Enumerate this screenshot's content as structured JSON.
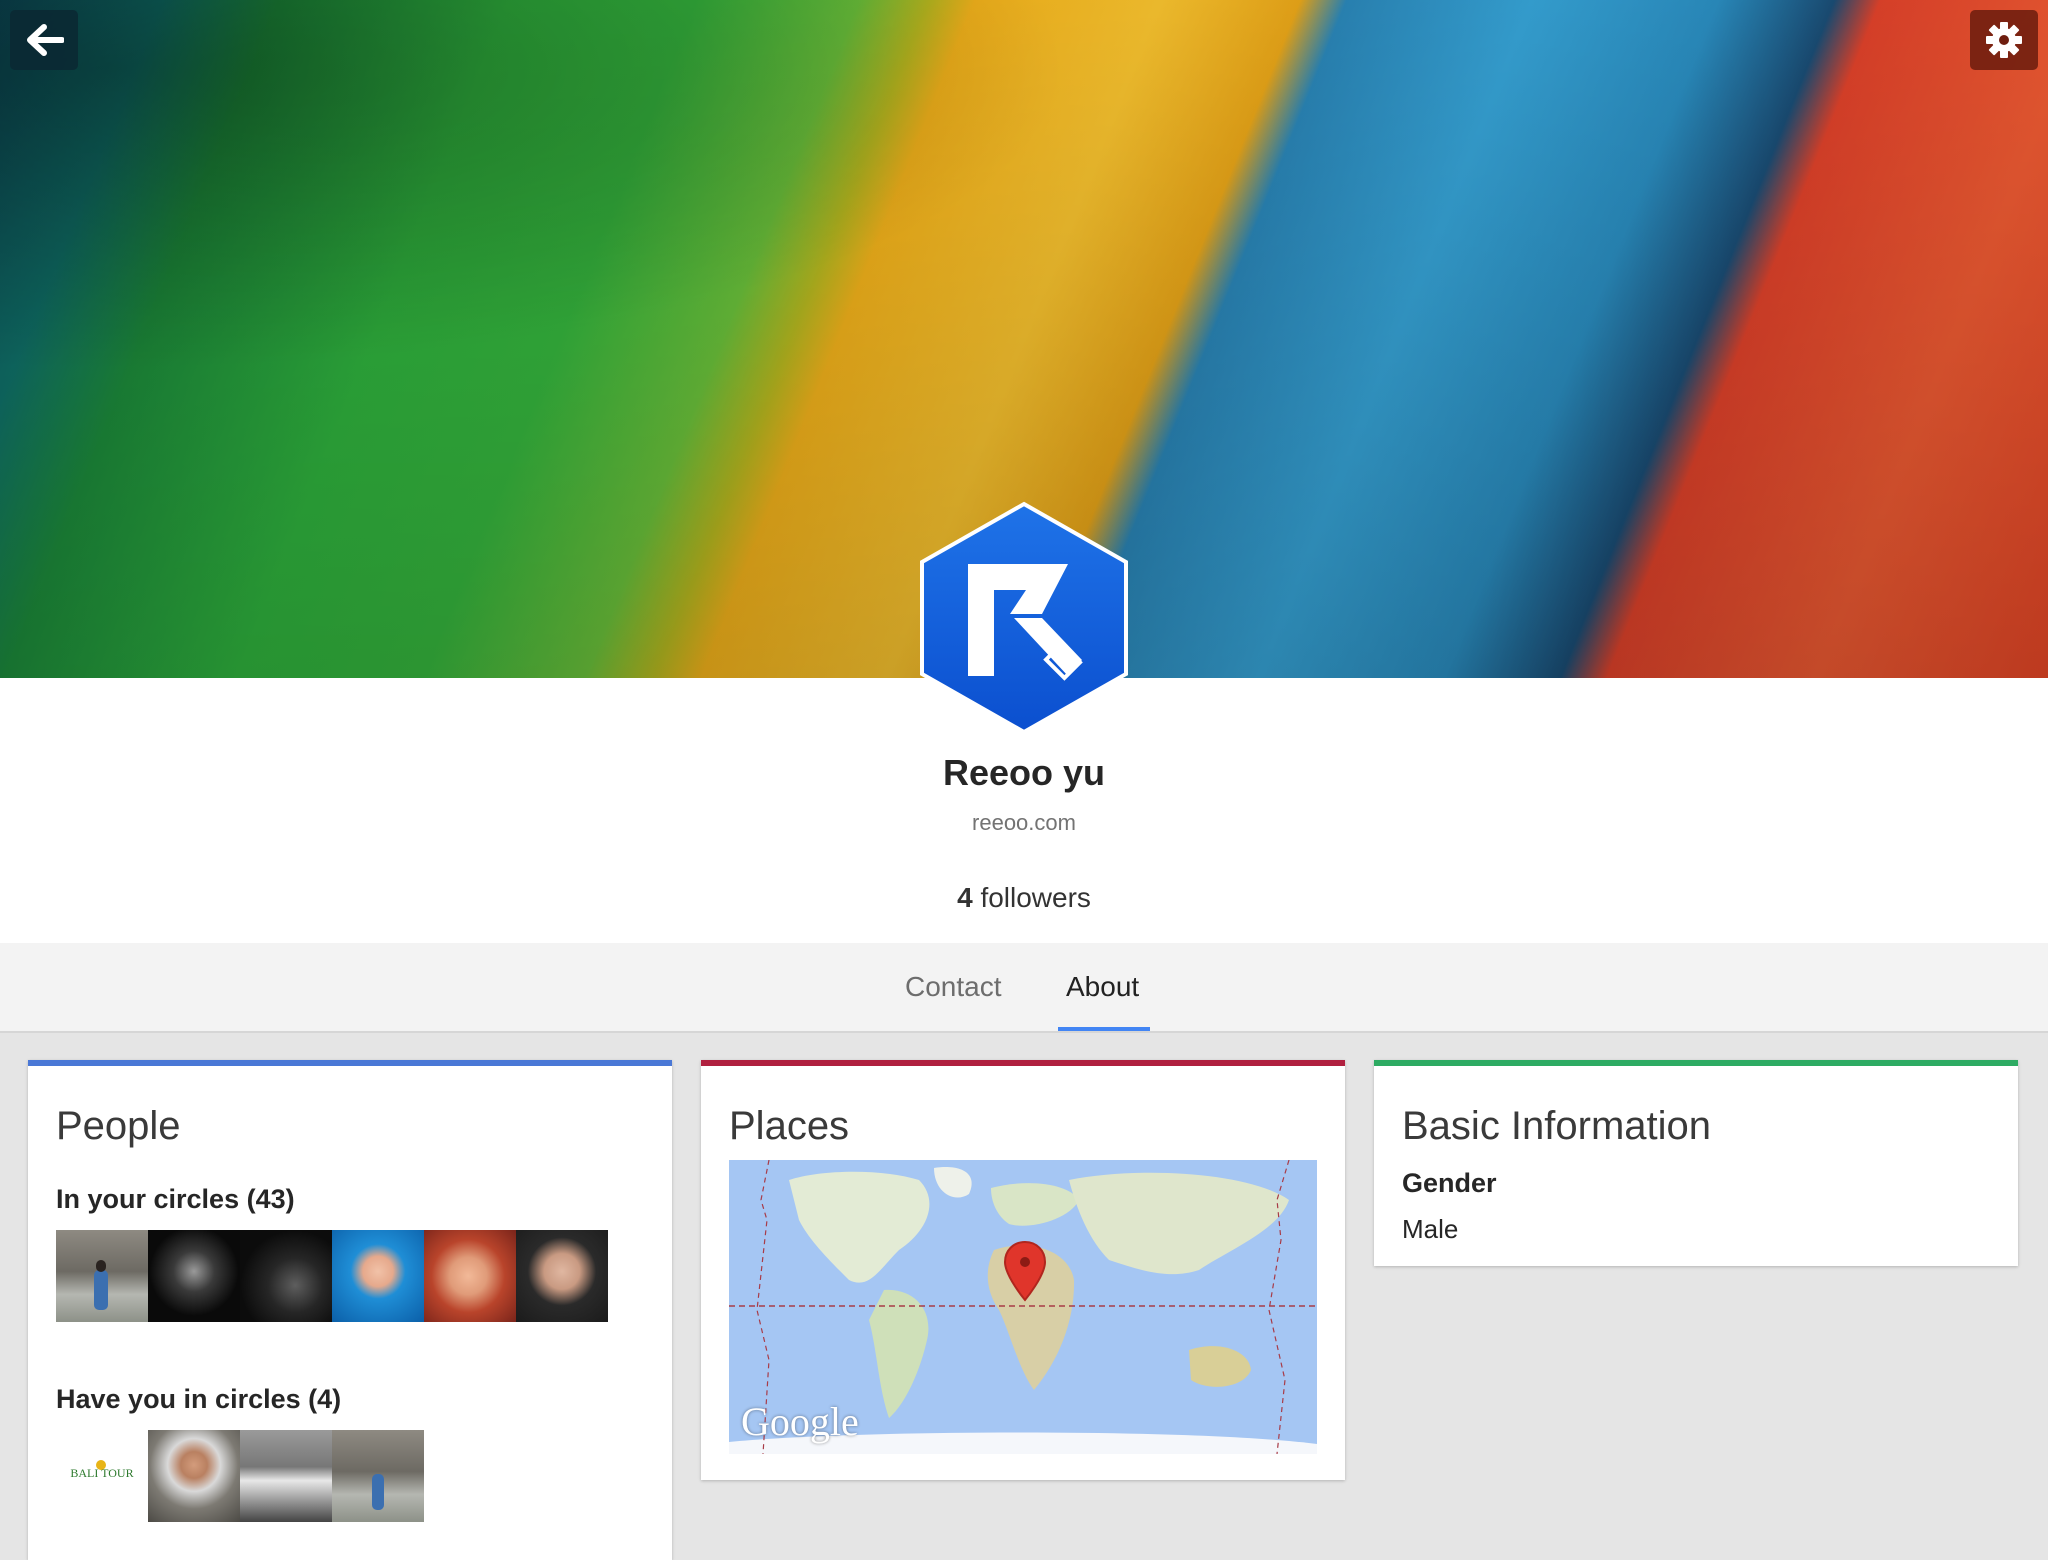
{
  "header": {
    "back_icon": "arrow-left-icon",
    "settings_icon": "gear-icon"
  },
  "profile": {
    "name": "Reeoo yu",
    "website": "reeoo.com",
    "followers_count": "4",
    "followers_label": "followers"
  },
  "tabs": [
    {
      "label": "Contact",
      "active": false
    },
    {
      "label": "About",
      "active": true
    }
  ],
  "colors": {
    "people_accent": "#4a78d6",
    "places_accent": "#b0203f",
    "basic_accent": "#2eab63",
    "tab_indicator": "#4285f4"
  },
  "people": {
    "title": "People",
    "in_circles_label": "In your circles (43)",
    "have_you_label": "Have you in circles (4)"
  },
  "places": {
    "title": "Places",
    "map_brand": "Google"
  },
  "basic": {
    "title": "Basic Information",
    "gender_label": "Gender",
    "gender_value": "Male"
  },
  "have_you_logo_text": "BALI TOUR"
}
